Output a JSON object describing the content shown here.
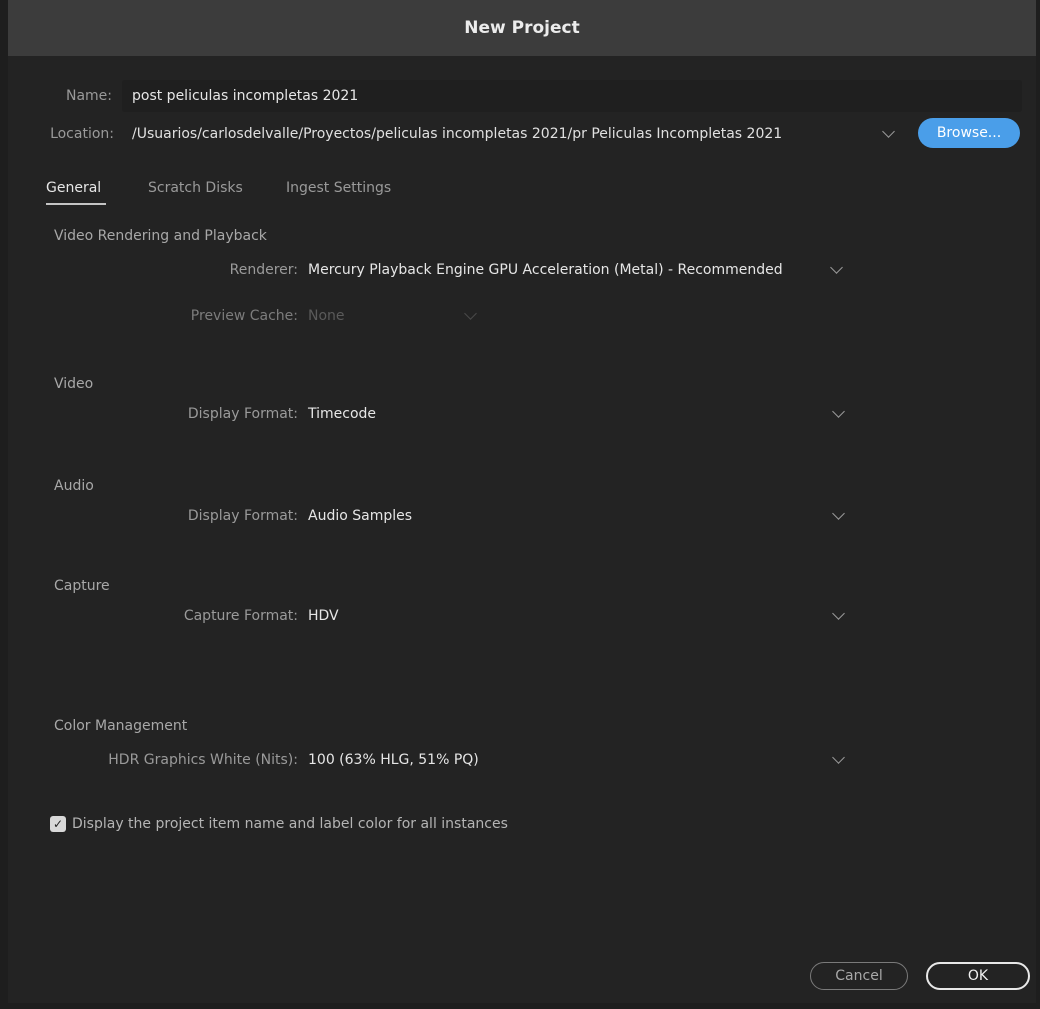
{
  "window": {
    "title": "New Project"
  },
  "name_field": {
    "label": "Name:",
    "value": "post peliculas incompletas 2021"
  },
  "location": {
    "label": "Location:",
    "value": "/Usuarios/carlosdelvalle/Proyectos/peliculas incompletas 2021/pr Peliculas Incompletas 2021",
    "browse_label": "Browse..."
  },
  "tabs": [
    {
      "label": "General",
      "active": true
    },
    {
      "label": "Scratch Disks",
      "active": false
    },
    {
      "label": "Ingest Settings",
      "active": false
    }
  ],
  "video_rendering": {
    "heading": "Video Rendering and Playback",
    "renderer_label": "Renderer:",
    "renderer_value": "Mercury Playback Engine GPU Acceleration (Metal) - Recommended",
    "preview_cache_label": "Preview Cache:",
    "preview_cache_value": "None"
  },
  "video": {
    "heading": "Video",
    "label": "Display Format:",
    "value": "Timecode"
  },
  "audio": {
    "heading": "Audio",
    "label": "Display Format:",
    "value": "Audio Samples"
  },
  "capture": {
    "heading": "Capture",
    "label": "Capture Format:",
    "value": "HDV"
  },
  "color_management": {
    "heading": "Color Management",
    "label": "HDR Graphics White (Nits):",
    "value": "100 (63% HLG, 51% PQ)"
  },
  "display_checkbox": {
    "checked": true,
    "label": "Display the project item name and label color for all instances"
  },
  "footer": {
    "cancel_label": "Cancel",
    "ok_label": "OK"
  },
  "colors": {
    "accent": "#4a9ee9",
    "background": "#232323",
    "titlebar": "#3c3c3c"
  }
}
